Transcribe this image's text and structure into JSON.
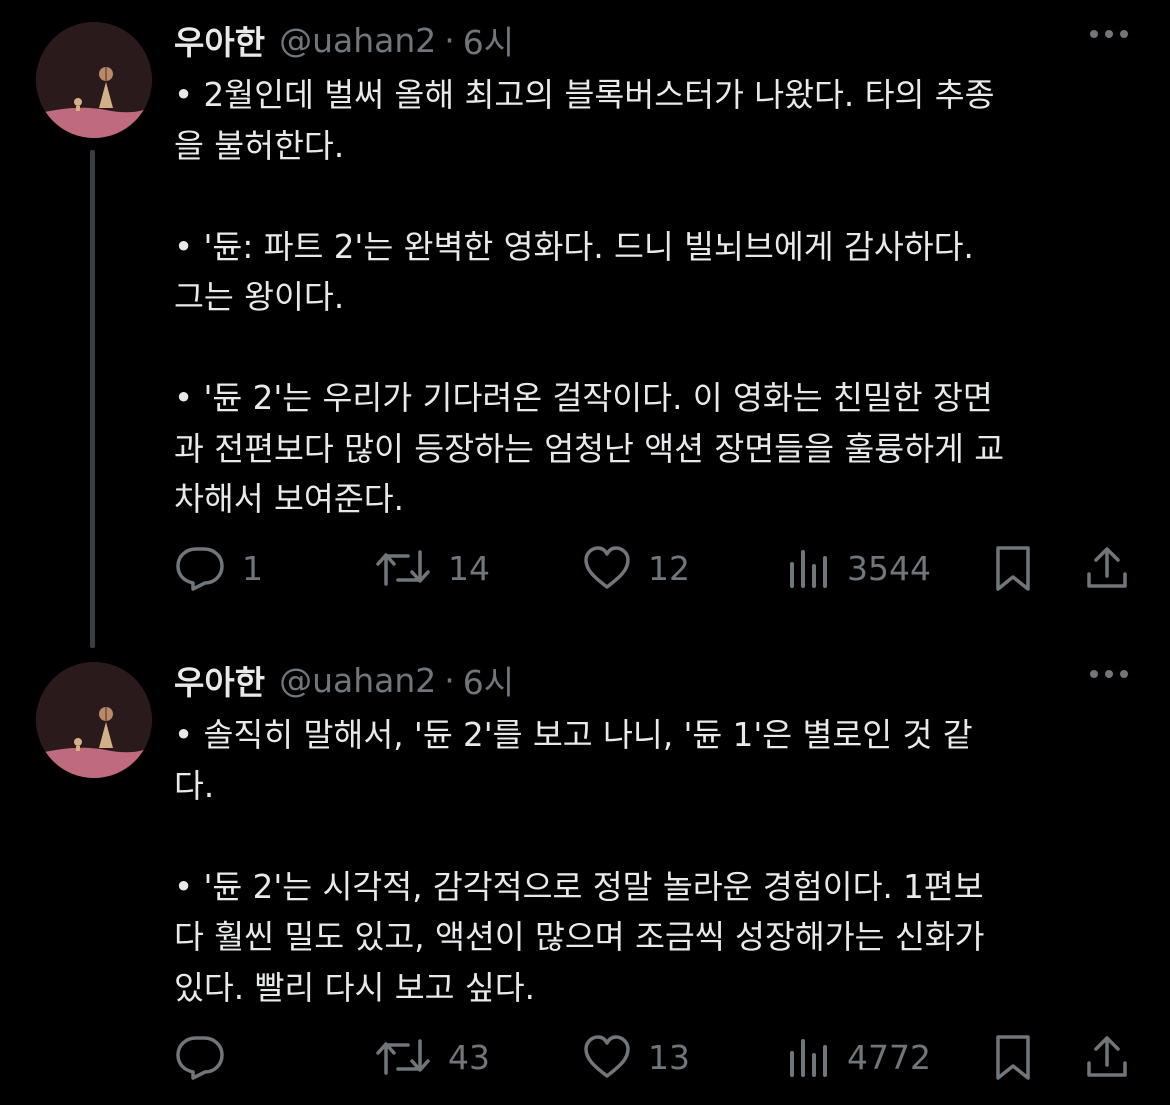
{
  "tweets": [
    {
      "author": {
        "name": "우아한",
        "handle": "@uahan2"
      },
      "separator": "·",
      "time": "6시",
      "paragraphs": [
        "• 2월인데 벌써 올해 최고의 블록버스터가 나왔다. 타의 추종\n을 불허한다.",
        "• '듄: 파트 2'는 완벽한 영화다. 드니 빌뇌브에게 감사하다.\n그는 왕이다.",
        "• '듄 2'는 우리가 기다려온 걸작이다. 이 영화는 친밀한 장면\n과 전편보다 많이 등장하는 엄청난 액션 장면들을 훌륭하게 교\n차해서 보여준다."
      ],
      "stats": {
        "replies": "1",
        "reposts": "14",
        "likes": "12",
        "views": "3544"
      }
    },
    {
      "author": {
        "name": "우아한",
        "handle": "@uahan2"
      },
      "separator": "·",
      "time": "6시",
      "paragraphs": [
        "• 솔직히 말해서, '듄 2'를 보고 나니, '듄 1'은 별로인 것 같\n다.",
        "• '듄 2'는 시각적, 감각적으로 정말 놀라운 경험이다. 1편보\n다 훨씬 밀도 있고, 액션이 많으며 조금씩 성장해가는 신화가\n있다. 빨리 다시 보고 싶다."
      ],
      "stats": {
        "replies": "",
        "reposts": "43",
        "likes": "13",
        "views": "4772"
      }
    }
  ],
  "icons": {
    "reply": "reply-icon",
    "repost": "repost-icon",
    "like": "heart-icon",
    "views": "views-icon",
    "bookmark": "bookmark-icon",
    "share": "share-icon",
    "more": "more-icon"
  },
  "colors": {
    "background": "#000000",
    "text": "#e7e9ea",
    "muted": "#71767b",
    "thread_line": "#3a3d41"
  }
}
